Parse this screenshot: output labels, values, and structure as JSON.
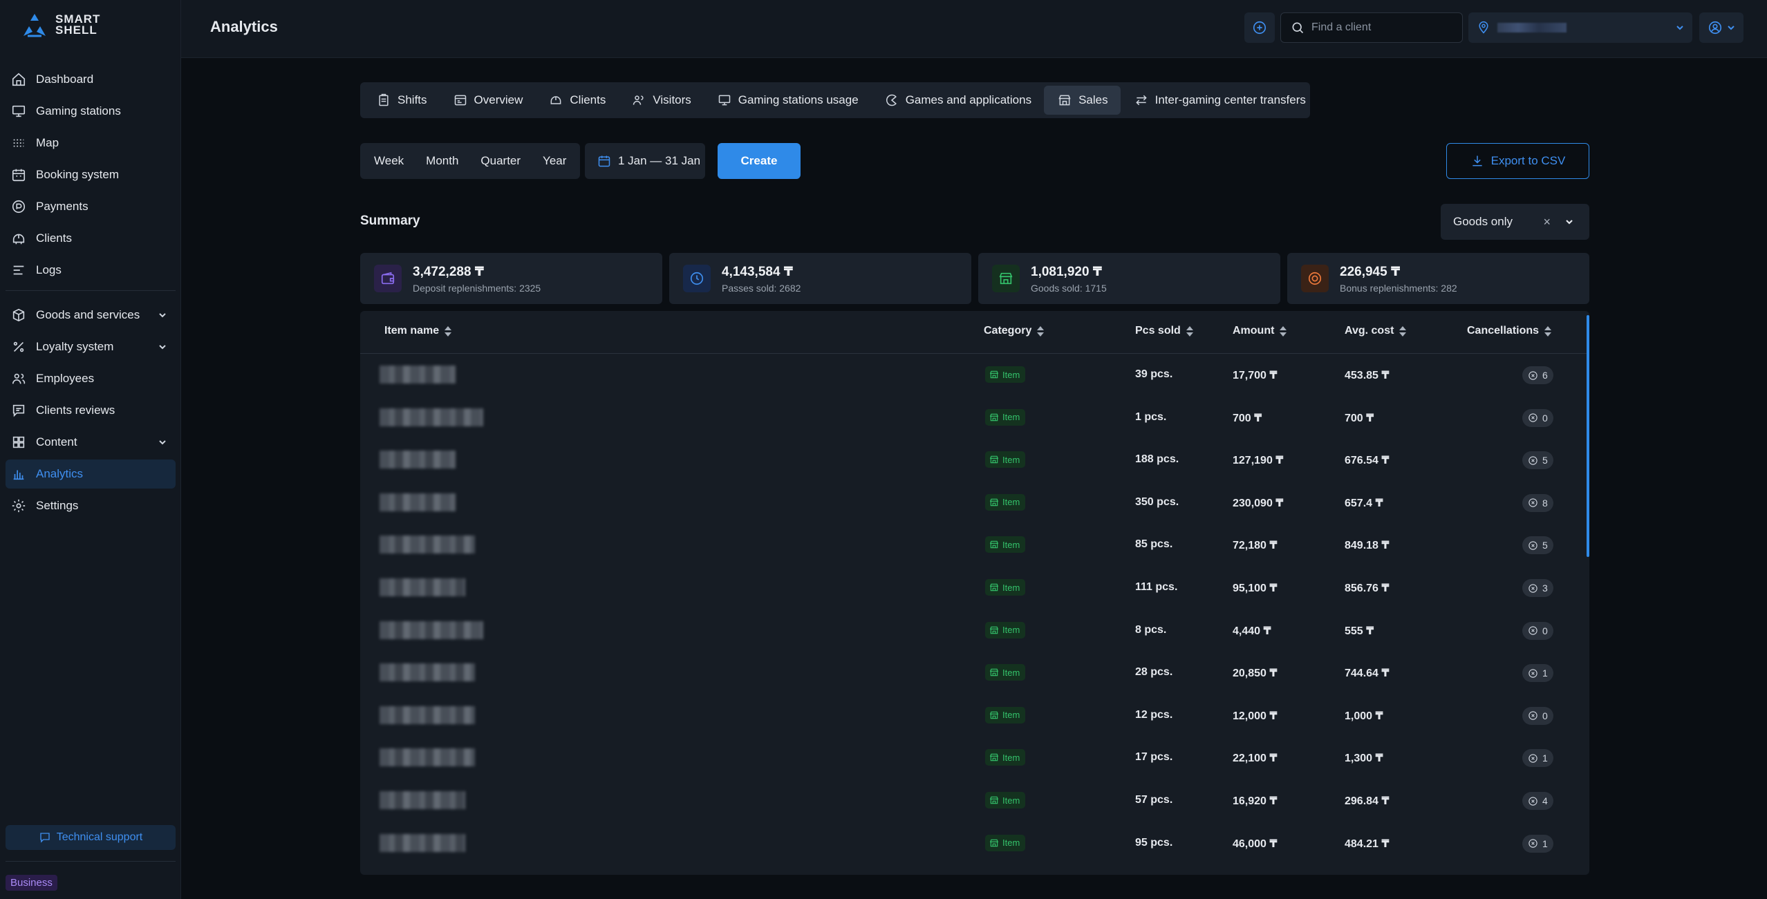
{
  "app": {
    "brand_line1": "SMART",
    "brand_line2": "SHELL",
    "page_title": "Analytics",
    "search_placeholder": "Find a client",
    "support_label": "Technical support",
    "plan_badge": "Business"
  },
  "sidebar": {
    "items": [
      {
        "label": "Dashboard",
        "icon": "home-icon"
      },
      {
        "label": "Gaming stations",
        "icon": "monitor-icon"
      },
      {
        "label": "Map",
        "icon": "grid-dots-icon"
      },
      {
        "label": "Booking system",
        "icon": "calendar-icon"
      },
      {
        "label": "Payments",
        "icon": "coin-icon"
      },
      {
        "label": "Clients",
        "icon": "helmet-icon"
      },
      {
        "label": "Logs",
        "icon": "list-icon"
      },
      {
        "label": "Goods and services",
        "icon": "box-icon",
        "expandable": true
      },
      {
        "label": "Loyalty system",
        "icon": "percent-icon",
        "expandable": true
      },
      {
        "label": "Employees",
        "icon": "users-icon"
      },
      {
        "label": "Clients reviews",
        "icon": "message-icon"
      },
      {
        "label": "Content",
        "icon": "layout-icon",
        "expandable": true
      },
      {
        "label": "Analytics",
        "icon": "chart-icon",
        "active": true
      },
      {
        "label": "Settings",
        "icon": "gear-icon"
      }
    ]
  },
  "tabs": [
    {
      "label": "Shifts"
    },
    {
      "label": "Overview"
    },
    {
      "label": "Clients"
    },
    {
      "label": "Visitors"
    },
    {
      "label": "Gaming stations usage"
    },
    {
      "label": "Games and applications"
    },
    {
      "label": "Sales",
      "active": true
    },
    {
      "label": "Inter-gaming center transfers"
    }
  ],
  "controls": {
    "periods": [
      "Week",
      "Month",
      "Quarter",
      "Year"
    ],
    "date_range": "1 Jan — 31 Jan",
    "create_label": "Create",
    "export_label": "Export to CSV",
    "summary_title": "Summary",
    "filter_value": "Goods only",
    "filter_clear": "×"
  },
  "stats": [
    {
      "value": "3,472,288 ₸",
      "label": "Deposit replenishments: 2325",
      "color": "#8b6cf0"
    },
    {
      "value": "4,143,584 ₸",
      "label": "Passes sold: 2682",
      "color": "#3f8ff0"
    },
    {
      "value": "1,081,920 ₸",
      "label": "Goods sold: 1715",
      "color": "#34c26b"
    },
    {
      "value": "226,945 ₸",
      "label": "Bonus replenishments: 282",
      "color": "#f07a3c"
    }
  ],
  "table": {
    "headers": [
      "Item name",
      "Category",
      "Pcs sold",
      "Amount",
      "Avg. cost",
      "Cancellations"
    ],
    "rows": [
      {
        "category": "Item",
        "pcs": "39 pcs.",
        "amount": "17,700 ₸",
        "avg": "453.85 ₸",
        "cancel": "6"
      },
      {
        "category": "Item",
        "pcs": "1 pcs.",
        "amount": "700 ₸",
        "avg": "700 ₸",
        "cancel": "0"
      },
      {
        "category": "Item",
        "pcs": "188 pcs.",
        "amount": "127,190 ₸",
        "avg": "676.54 ₸",
        "cancel": "5"
      },
      {
        "category": "Item",
        "pcs": "350 pcs.",
        "amount": "230,090 ₸",
        "avg": "657.4 ₸",
        "cancel": "8"
      },
      {
        "category": "Item",
        "pcs": "85 pcs.",
        "amount": "72,180 ₸",
        "avg": "849.18 ₸",
        "cancel": "5"
      },
      {
        "category": "Item",
        "pcs": "111 pcs.",
        "amount": "95,100 ₸",
        "avg": "856.76 ₸",
        "cancel": "3"
      },
      {
        "category": "Item",
        "pcs": "8 pcs.",
        "amount": "4,440 ₸",
        "avg": "555 ₸",
        "cancel": "0"
      },
      {
        "category": "Item",
        "pcs": "28 pcs.",
        "amount": "20,850 ₸",
        "avg": "744.64 ₸",
        "cancel": "1"
      },
      {
        "category": "Item",
        "pcs": "12 pcs.",
        "amount": "12,000 ₸",
        "avg": "1,000 ₸",
        "cancel": "0"
      },
      {
        "category": "Item",
        "pcs": "17 pcs.",
        "amount": "22,100 ₸",
        "avg": "1,300 ₸",
        "cancel": "1"
      },
      {
        "category": "Item",
        "pcs": "57 pcs.",
        "amount": "16,920 ₸",
        "avg": "296.84 ₸",
        "cancel": "4"
      },
      {
        "category": "Item",
        "pcs": "95 pcs.",
        "amount": "46,000 ₸",
        "avg": "484.21 ₸",
        "cancel": "1"
      }
    ]
  }
}
